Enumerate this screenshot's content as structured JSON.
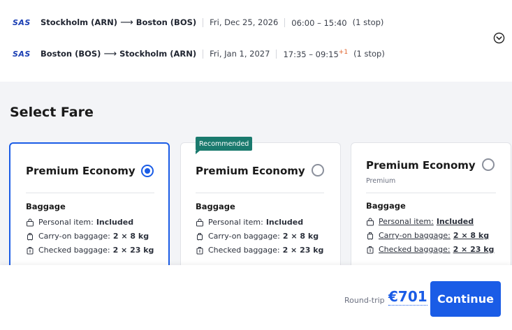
{
  "flights": [
    {
      "airline": "SAS",
      "origin": "Stockholm (ARN)",
      "destination": "Boston (BOS)",
      "date": "Fri, Dec 25, 2026",
      "time": "06:00 – 15:40",
      "day_offset": "",
      "stops": "(1 stop)"
    },
    {
      "airline": "SAS",
      "origin": "Boston (BOS)",
      "destination": "Stockholm (ARN)",
      "date": "Fri, Jan 1, 2027",
      "time": "17:35 – 09:15",
      "day_offset": "+1",
      "stops": "(1 stop)"
    }
  ],
  "section_title": "Select Fare",
  "fares": [
    {
      "name": "Premium Economy",
      "subtitle": "",
      "badge": "",
      "selected": true,
      "baggage_title": "Baggage",
      "baggage": [
        {
          "label": "Personal item:",
          "value": "Included"
        },
        {
          "label": "Carry-on baggage:",
          "value": "2 × 8 kg"
        },
        {
          "label": "Checked baggage:",
          "value": "2 × 23 kg"
        }
      ]
    },
    {
      "name": "Premium Economy",
      "subtitle": "",
      "badge": "Recommended",
      "selected": false,
      "baggage_title": "Baggage",
      "baggage": [
        {
          "label": "Personal item:",
          "value": "Included"
        },
        {
          "label": "Carry-on baggage:",
          "value": "2 × 8 kg"
        },
        {
          "label": "Checked baggage:",
          "value": "2 × 23 kg"
        }
      ]
    },
    {
      "name": "Premium Economy",
      "subtitle": "Premium",
      "badge": "",
      "selected": false,
      "baggage_title": "Baggage",
      "baggage": [
        {
          "label": "Personal item:",
          "value": "Included"
        },
        {
          "label": "Carry-on baggage:",
          "value": "2 × 8 kg"
        },
        {
          "label": "Checked baggage:",
          "value": "2 × 23 kg"
        }
      ]
    }
  ],
  "footer": {
    "price_label": "Round-trip",
    "price": "€701",
    "continue_label": "Continue"
  },
  "colors": {
    "accent": "#1a5ce6",
    "badge": "#1a7a6e",
    "airline": "#1a3eb3",
    "day_offset": "#e0622a"
  },
  "icons": {
    "expand": "chevron-down-circle-icon",
    "personal_item": "bag-icon",
    "carry_on": "carry-on-icon",
    "checked": "suitcase-icon"
  }
}
